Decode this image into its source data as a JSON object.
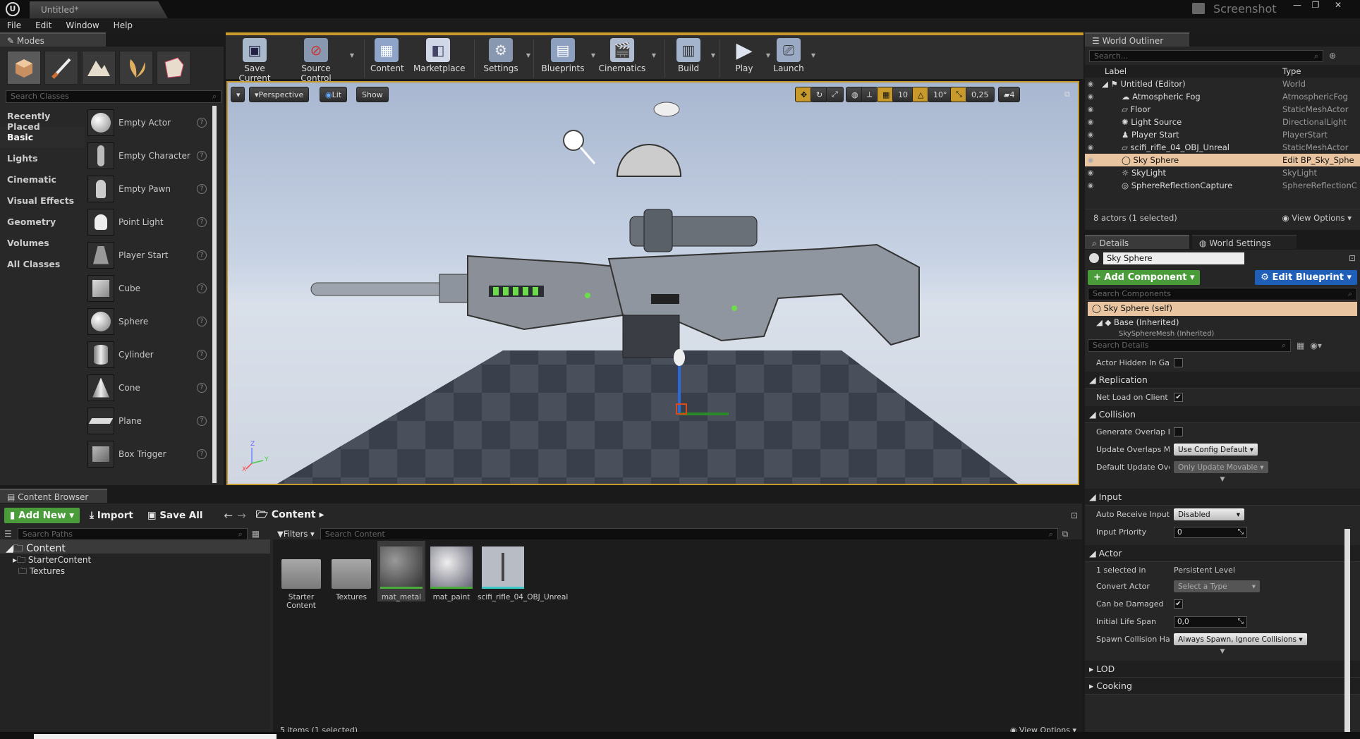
{
  "window": {
    "doc_tab": "Untitled*",
    "logo": "U",
    "screenshot_label": "Screenshot",
    "controls": [
      "—",
      "❐",
      "✕"
    ]
  },
  "menu": [
    "File",
    "Edit",
    "Window",
    "Help"
  ],
  "modes": {
    "tab": "Modes",
    "search_placeholder": "Search Classes",
    "categories": [
      "Recently Placed",
      "Basic",
      "Lights",
      "Cinematic",
      "Visual Effects",
      "Geometry",
      "Volumes",
      "All Classes"
    ],
    "selected_category": "Basic",
    "classes": [
      "Empty Actor",
      "Empty Character",
      "Empty Pawn",
      "Point Light",
      "Player Start",
      "Cube",
      "Sphere",
      "Cylinder",
      "Cone",
      "Plane",
      "Box Trigger"
    ]
  },
  "toolbar": {
    "items": [
      "Save Current",
      "Source Control",
      "Content",
      "Marketplace",
      "Settings",
      "Blueprints",
      "Cinematics",
      "Build",
      "Play",
      "Launch"
    ]
  },
  "viewport": {
    "perspective": "Perspective",
    "lit": "Lit",
    "show": "Show",
    "grid_snap": "10",
    "rot_snap": "10°",
    "scale_snap": "0,25",
    "cam_speed": "4",
    "axis_z": "Z",
    "axis_x": "X",
    "axis_y": "Y"
  },
  "outliner": {
    "tab": "World Outliner",
    "search_placeholder": "Search...",
    "col_label": "Label",
    "col_type": "Type",
    "rows": [
      {
        "label": "Untitled (Editor)",
        "type": "World"
      },
      {
        "label": "Atmospheric Fog",
        "type": "AtmosphericFog"
      },
      {
        "label": "Floor",
        "type": "StaticMeshActor"
      },
      {
        "label": "Light Source",
        "type": "DirectionalLight"
      },
      {
        "label": "Player Start",
        "type": "PlayerStart"
      },
      {
        "label": "scifi_rifle_04_OBJ_Unreal",
        "type": "StaticMeshActor"
      },
      {
        "label": "Sky Sphere",
        "type": "Edit BP_Sky_Sphe"
      },
      {
        "label": "SkyLight",
        "type": "SkyLight"
      },
      {
        "label": "SphereReflectionCapture",
        "type": "SphereReflectionC"
      }
    ],
    "selected_index": 6,
    "footer_count": "8 actors (1 selected)",
    "view_options": "View Options"
  },
  "details": {
    "tab": "Details",
    "tab2": "World Settings",
    "name_value": "Sky Sphere",
    "add_component": "+ Add Component",
    "edit_blueprint": "Edit Blueprint",
    "search_components": "Search Components",
    "comp_self": "Sky Sphere (self)",
    "comp_base": "Base (Inherited)",
    "comp_mesh": "SkySphereMesh (Inherited)",
    "search_details": "Search Details",
    "actor_hidden": "Actor Hidden In Game",
    "sec_replication": "Replication",
    "net_load": "Net Load on Client",
    "sec_collision": "Collision",
    "gen_overlap": "Generate Overlap Ever",
    "upd_overlap": "Update Overlaps Meth",
    "upd_overlap_val": "Use Config Default",
    "def_upd_overlap": "Default Update Overla",
    "def_upd_overlap_val": "Only Update Movable",
    "sec_input": "Input",
    "auto_receive": "Auto Receive Input",
    "auto_receive_val": "Disabled",
    "input_priority": "Input Priority",
    "input_priority_val": "0",
    "sec_actor": "Actor",
    "selected_in": "1 selected in",
    "selected_in_val": "Persistent Level",
    "convert_actor": "Convert Actor",
    "convert_actor_val": "Select a Type",
    "can_be_damaged": "Can be Damaged",
    "initial_life": "Initial Life Span",
    "initial_life_val": "0,0",
    "spawn_collision": "Spawn Collision Handl",
    "spawn_collision_val": "Always Spawn, Ignore Collisions",
    "sec_lod": "LOD",
    "sec_cooking": "Cooking"
  },
  "content_browser": {
    "tab": "Content Browser",
    "add_new": "Add New",
    "import": "Import",
    "save_all": "Save All",
    "path": "Content",
    "search_paths": "Search Paths",
    "filters": "Filters",
    "search_content": "Search Content",
    "tree": [
      "Content",
      "StarterContent",
      "Textures"
    ],
    "assets": [
      {
        "name": "Starter Content",
        "kind": "folder"
      },
      {
        "name": "Textures",
        "kind": "folder"
      },
      {
        "name": "mat_metal",
        "kind": "material"
      },
      {
        "name": "mat_paint",
        "kind": "material"
      },
      {
        "name": "scifi_rifle_04_OBJ_Unreal",
        "kind": "mesh"
      }
    ],
    "status": "5 items (1 selected)",
    "view_options": "View Options"
  },
  "colors": {
    "accent_gold": "#c79a2b",
    "selection": "#e8c5a0",
    "green_button": "#4a9c3a",
    "blue_button": "#1f5fb8"
  }
}
